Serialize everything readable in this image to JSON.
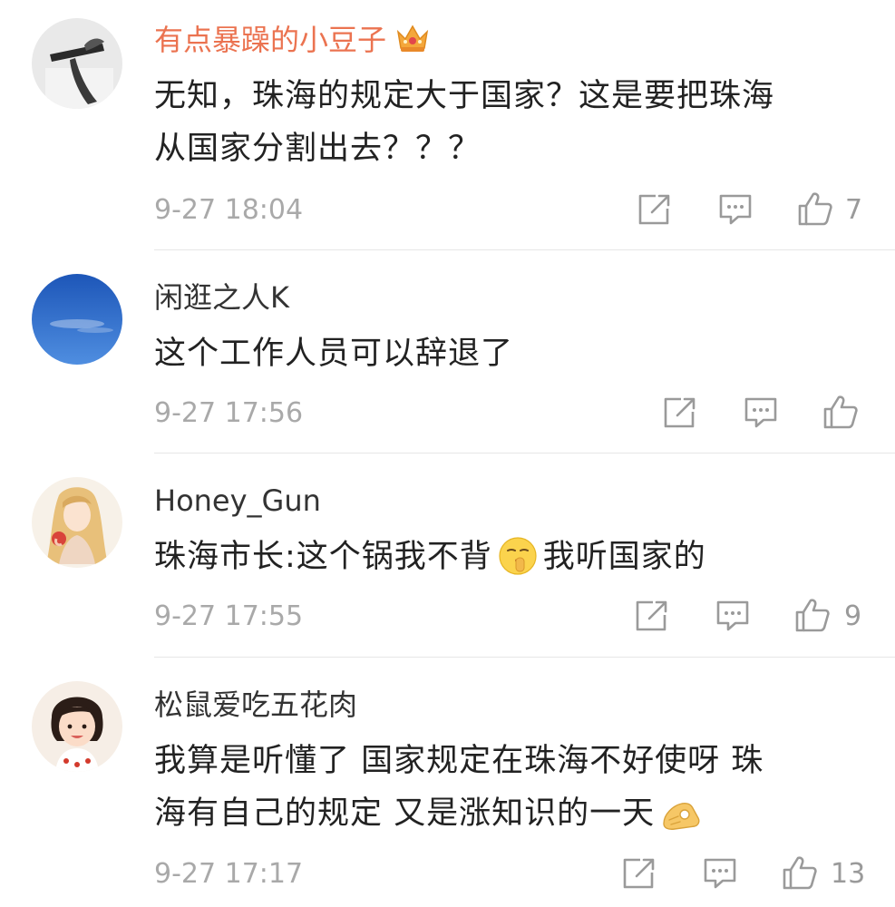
{
  "comments": [
    {
      "username": "有点暴躁的小豆子",
      "vip_badge": "crown-icon",
      "line1": "无知，珠海的规定大于国家？这是要把珠海",
      "line2": "从国家分割出去？？？",
      "time": "9-27 18:04",
      "likes": "7"
    },
    {
      "username": "闲逛之人K",
      "line1": "这个工作人员可以辞退了",
      "time": "9-27 17:56",
      "likes": ""
    },
    {
      "username": "Honey_Gun",
      "text_before": "珠海市长:这个锅我不背",
      "emoji": "shush-emoji",
      "text_after": "我听国家的",
      "time": "9-27 17:55",
      "likes": "9"
    },
    {
      "username": "松鼠爱吃五花肉",
      "line1": "我算是听懂了 国家规定在珠海不好使呀 珠",
      "line2_before": "海有自己的规定 又是涨知识的一天",
      "emoji": "ok-hand-emoji",
      "time": "9-27 17:17",
      "likes": "13"
    }
  ],
  "colors": {
    "vip_name": "#eb7350",
    "name": "#333333",
    "text": "#222222",
    "meta": "#a9a9a9",
    "divider": "#e6e6e6"
  }
}
